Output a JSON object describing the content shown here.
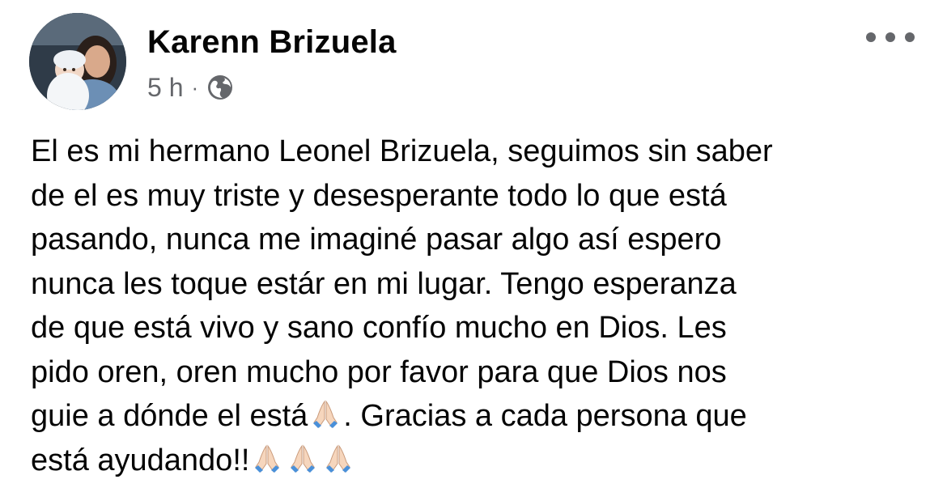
{
  "post": {
    "author": "Karenn Brizuela",
    "timestamp": "5 h",
    "separator": "·",
    "audience_icon": "globe-icon",
    "more_icon": "more-options-icon",
    "body_lines": [
      "El es mi hermano Leonel Brizuela, seguimos sin saber",
      "de el es muy triste y desesperante todo lo que está",
      "pasando, nunca me imaginé pasar algo así espero",
      "nunca les toque estár en mi lugar. Tengo esperanza",
      "de que está vivo y sano confío mucho en Dios. Les",
      "pido oren, oren mucho por favor para que Dios nos"
    ],
    "line7_before": "guie a dónde el está",
    "line7_after": ". Gracias a cada persona que",
    "line8": "está ayudando!!",
    "emoji_name": "folded-hands-emoji",
    "colors": {
      "text": "#050505",
      "secondary": "#65676b"
    }
  }
}
